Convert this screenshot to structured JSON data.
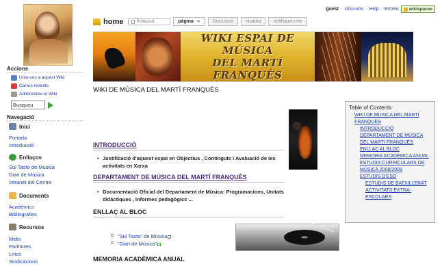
{
  "topnav": {
    "user": "guest",
    "join_link": "Uniu-vos",
    "help_link": "Help",
    "signin_link": "Entreu",
    "wikispaces_label": "wikispaces"
  },
  "page": {
    "title": "home",
    "protected_label": "Protected",
    "tabs": [
      {
        "label": "pàgina",
        "active": true
      },
      {
        "label": "Discussió",
        "active": false
      },
      {
        "label": "història",
        "active": false
      },
      {
        "label": "notifiqueu-me",
        "active": false
      }
    ]
  },
  "banner": {
    "title_line1": "WIKI ESPAI DE MÚSICA",
    "title_line2": "DEL MARTÍ FRANQUÈS"
  },
  "sidebar": {
    "actions_heading": "Accions",
    "actions": [
      {
        "label": "Uniu-vos a aquest Wiki",
        "icon": "user-add-icon",
        "color": "#5a7fbf"
      },
      {
        "label": "Canvis recents",
        "icon": "calendar-icon",
        "color": "#d04040"
      },
      {
        "label": "Administreu el Wiki",
        "icon": "admin-icon",
        "color": "#999999"
      }
    ],
    "search_value": "Busqueu",
    "nav_heading": "Navegació",
    "groups": [
      {
        "title": "Inici",
        "icon": "home-icon",
        "color": "#6b7fa8",
        "links": [
          "Portada",
          "Introducció"
        ]
      },
      {
        "title": "Enllaços",
        "icon": "refresh-icon",
        "color": "#3a9a3a",
        "links": [
          "Sul Tasto de Música",
          "Diari de Música",
          "Intranet del Centre"
        ]
      },
      {
        "title": "Documents",
        "icon": "folder-icon",
        "color": "#e8b848",
        "links": [
          "Acadèmics",
          "Bibliografies"
        ]
      },
      {
        "title": "Recursos",
        "icon": "tools-icon",
        "color": "#8a7a6a",
        "links": [
          "Midis",
          "Partitures",
          "Lírics",
          "Sindicacions"
        ]
      }
    ]
  },
  "content": {
    "title": "WIKI DE MÚSICA DEL MARTÍ FRANQUÈS",
    "sections": [
      {
        "heading": "INTRODUCCIÓ",
        "bullets": [
          "Justificació d'aquest espai en Objectius , Continguts i Avaluació de les activitats en Xarxa"
        ]
      },
      {
        "heading": "DEPARTAMENT DE MÚSICA DEL MARTÍ FRANQUÈS",
        "bullets": [
          "Documentació Oficial del Departament de Música: Programacions, Unitats didàctiques , Informes pedagògics ..."
        ]
      },
      {
        "heading": "ENLLAÇ AL BLOC",
        "links": [
          "\"Sul Tasto\" de Música",
          "\"Diari de Música\""
        ]
      },
      {
        "heading": "MEMORIA ACADÈMICA ANUAL"
      }
    ]
  },
  "toc": {
    "title": "Table of Contents",
    "items": [
      {
        "label": "WIKI DE MÚSICA DEL MARTÍ FRANQUÈS",
        "level": 1
      },
      {
        "label": "INTRODUCCIÓ",
        "level": 2
      },
      {
        "label": "DEPARTAMENT DE MÚSICA DEL MARTÍ FRANQUÈS",
        "level": 2
      },
      {
        "label": "ENLLAÇ AL BLOC",
        "level": 2
      },
      {
        "label": "MEMORIA ACADÈMICA ANUAL",
        "level": 2
      },
      {
        "label": "ESTUDIS CURRICULARS DE MÚSICA 2008/2009",
        "level": 2
      },
      {
        "label": "ESTUDIS D'ESO",
        "level": 2
      },
      {
        "label": "ESTUDIS DE BATXILLERAT",
        "level": 3
      },
      {
        "label": "ACTIVITATS EXTRA-ESCOLARS",
        "level": 3
      }
    ]
  }
}
